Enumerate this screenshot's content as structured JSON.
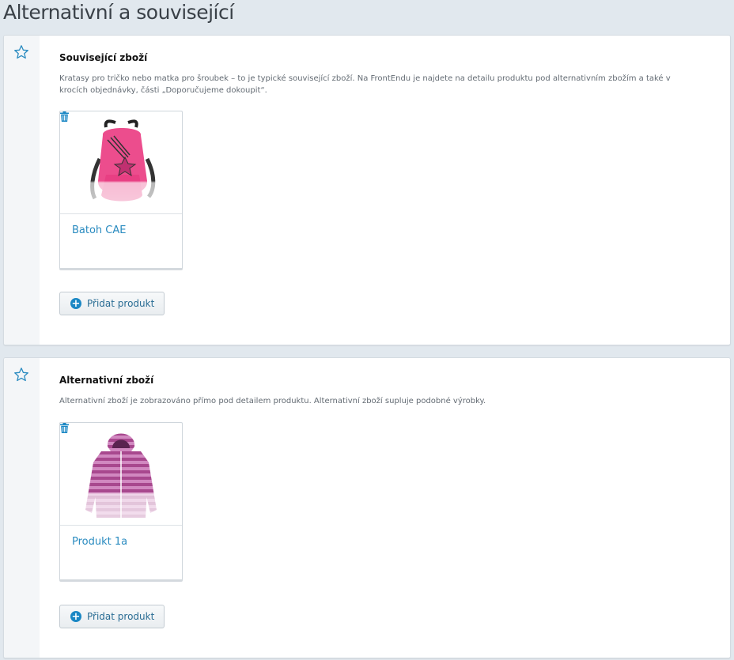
{
  "page": {
    "title": "Alternativní a související"
  },
  "sections": [
    {
      "title": "Související zboží",
      "description": "Kratasy pro tričko nebo matka pro šroubek – to je typické související zboží. Na FrontEndu je najdete na detailu produktu pod alternativním zbožím a také v krocích objednávky, části „Doporučujeme dokoupit“.",
      "products": [
        {
          "name": "Batoh CAE",
          "image": "backpack-pink"
        }
      ],
      "add_label": "Přidat produkt"
    },
    {
      "title": "Alternativní zboží",
      "description": "Alternativní zboží je zobrazováno přímo pod detailem produktu. Alternativní zboží supluje podobné výrobky.",
      "products": [
        {
          "name": "Produkt 1a",
          "image": "hoodie-purple"
        }
      ],
      "add_label": "Přidat produkt"
    }
  ],
  "icons": {
    "section": "star-icon",
    "remove": "trash-icon",
    "add": "plus-circle-icon"
  },
  "colors": {
    "accent": "#1a87c4",
    "link": "#2a8bc0",
    "background": "#e1e8ee"
  }
}
